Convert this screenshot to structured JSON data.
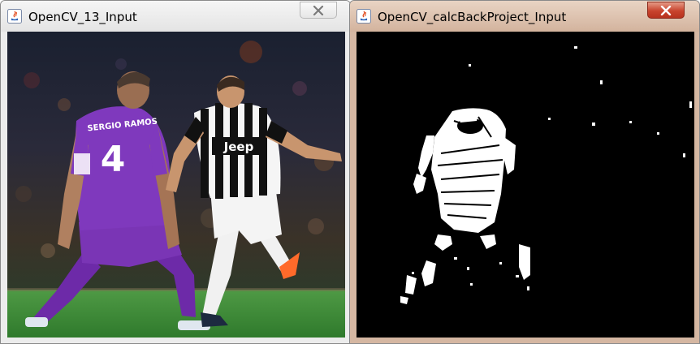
{
  "windows": [
    {
      "title": "OpenCV_13_Input",
      "active": false,
      "content": {
        "type": "photo",
        "jerseys": {
          "left_player_name": "SERGIO RAMOS",
          "left_player_number": "4",
          "right_player_sponsor": "Jeep"
        }
      }
    },
    {
      "title": "OpenCV_calcBackProject_Input",
      "active": true,
      "content": {
        "type": "backprojection-mask"
      }
    }
  ],
  "colors": {
    "inactive_frame": "#ececec",
    "active_frame": "#d5b7a2",
    "close_active": "#c8432d",
    "pitch_green": "#3f8a3a",
    "madrid_purple": "#7a35b5"
  },
  "icons": {
    "app": "java-icon",
    "close": "close-icon"
  }
}
